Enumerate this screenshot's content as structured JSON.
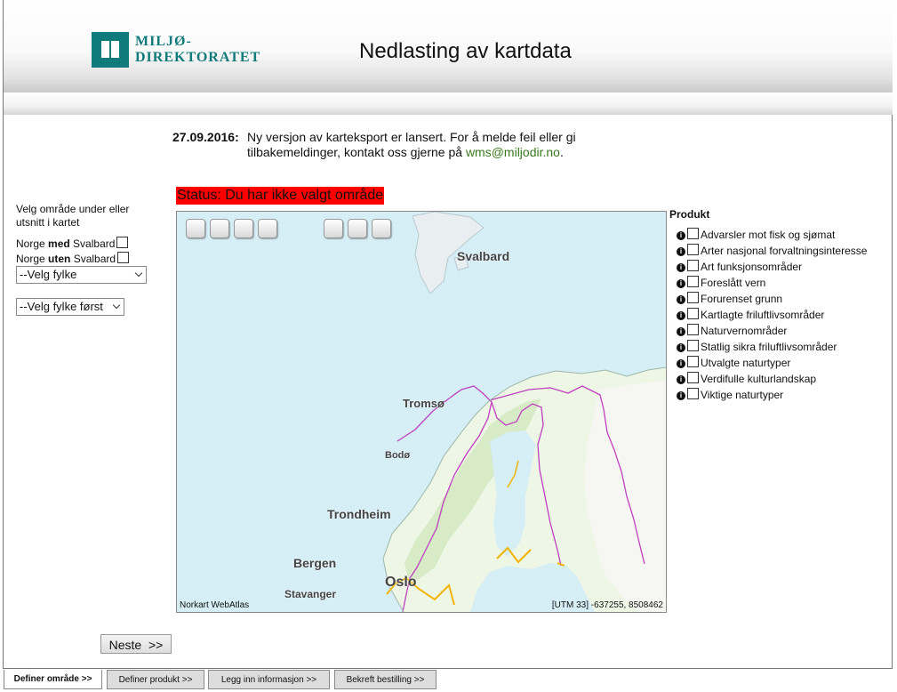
{
  "header": {
    "logo_line1": "MILJØ-",
    "logo_line2": "DIREKTORATET",
    "title": "Nedlasting av kartdata"
  },
  "news": {
    "date": "27.09.2016:",
    "text": "Ny versjon av karteksport er lansert. For å melde feil eller gi tilbakemeldinger, kontakt oss gjerne på ",
    "email": "wms@miljodir.no",
    "suffix": "."
  },
  "status": "Status: Du har ikke valgt område",
  "area_select": {
    "hint": "Velg område under eller utsnitt i kartet",
    "with_svalbard_prefix": "Norge ",
    "with_svalbard_bold": "med",
    "with_svalbard_suffix": " Svalbard",
    "without_svalbard_prefix": "Norge ",
    "without_svalbard_bold": "uten",
    "without_svalbard_suffix": " Svalbard",
    "county_select": "--Velg fylke",
    "municipality_select": "--Velg fylke først"
  },
  "map": {
    "labels": {
      "svalbard": "Svalbard",
      "tromso": "Tromsø",
      "bodo": "Bodø",
      "trondheim": "Trondheim",
      "bergen": "Bergen",
      "stavanger": "Stavanger",
      "oslo": "Oslo"
    },
    "attribution": "Norkart WebAtlas",
    "coordinates": "[UTM 33] -637255, 8508462",
    "colors": {
      "sea": "#d9f0f7",
      "land": "#eef6e6",
      "border": "#c040c0",
      "road": "#f2b400"
    }
  },
  "products": {
    "heading": "Produkt",
    "items": [
      "Advarsler mot fisk og sjømat",
      "Arter nasjonal forvaltningsinteresse",
      "Art funksjonsområder",
      "Foreslått vern",
      "Forurenset grunn",
      "Kartlagte friluftlivsområder",
      "Naturvernområder",
      "Statlig sikra friluftlivsområder",
      "Utvalgte naturtyper",
      "Verdifulle kulturlandskap",
      "Viktige naturtyper"
    ]
  },
  "next_button": "Neste  >>",
  "tabs": [
    "Definer område >>",
    "Definer produkt >>",
    "Legg inn informasjon >>",
    "Bekreft bestilling >>"
  ]
}
